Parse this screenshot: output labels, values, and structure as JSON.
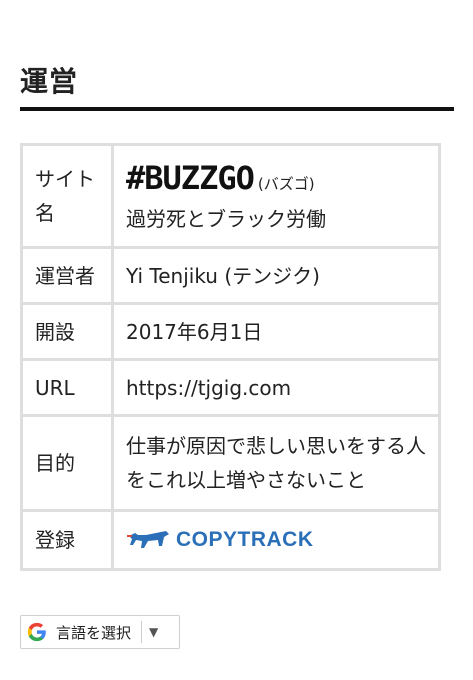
{
  "section": {
    "title": "運営"
  },
  "table": {
    "site": {
      "label": "サイト名",
      "brand": "#BUZZGO",
      "brand_kana": "(バズゴ)",
      "tagline": "過労死とブラック労働"
    },
    "operator": {
      "label": "運営者",
      "value": "Yi Tenjiku (テンジク)"
    },
    "opened": {
      "label": "開設",
      "value": "2017年6月1日"
    },
    "url": {
      "label": "URL",
      "value": "https://tjgig.com"
    },
    "purpose": {
      "label": "目的",
      "value": "仕事が原因で悲しい思いをする人をこれ以上増やさないこと"
    },
    "register": {
      "label": "登録",
      "logo_text": "COPYTRACK",
      "logo_icon": "dog-icon"
    }
  },
  "translate": {
    "label": "言語を選択",
    "arrow": "▼",
    "icon": "google-g-icon"
  },
  "colors": {
    "logo_blue": "#2a6fb8",
    "border": "#dedede",
    "title_rule": "#111111"
  }
}
